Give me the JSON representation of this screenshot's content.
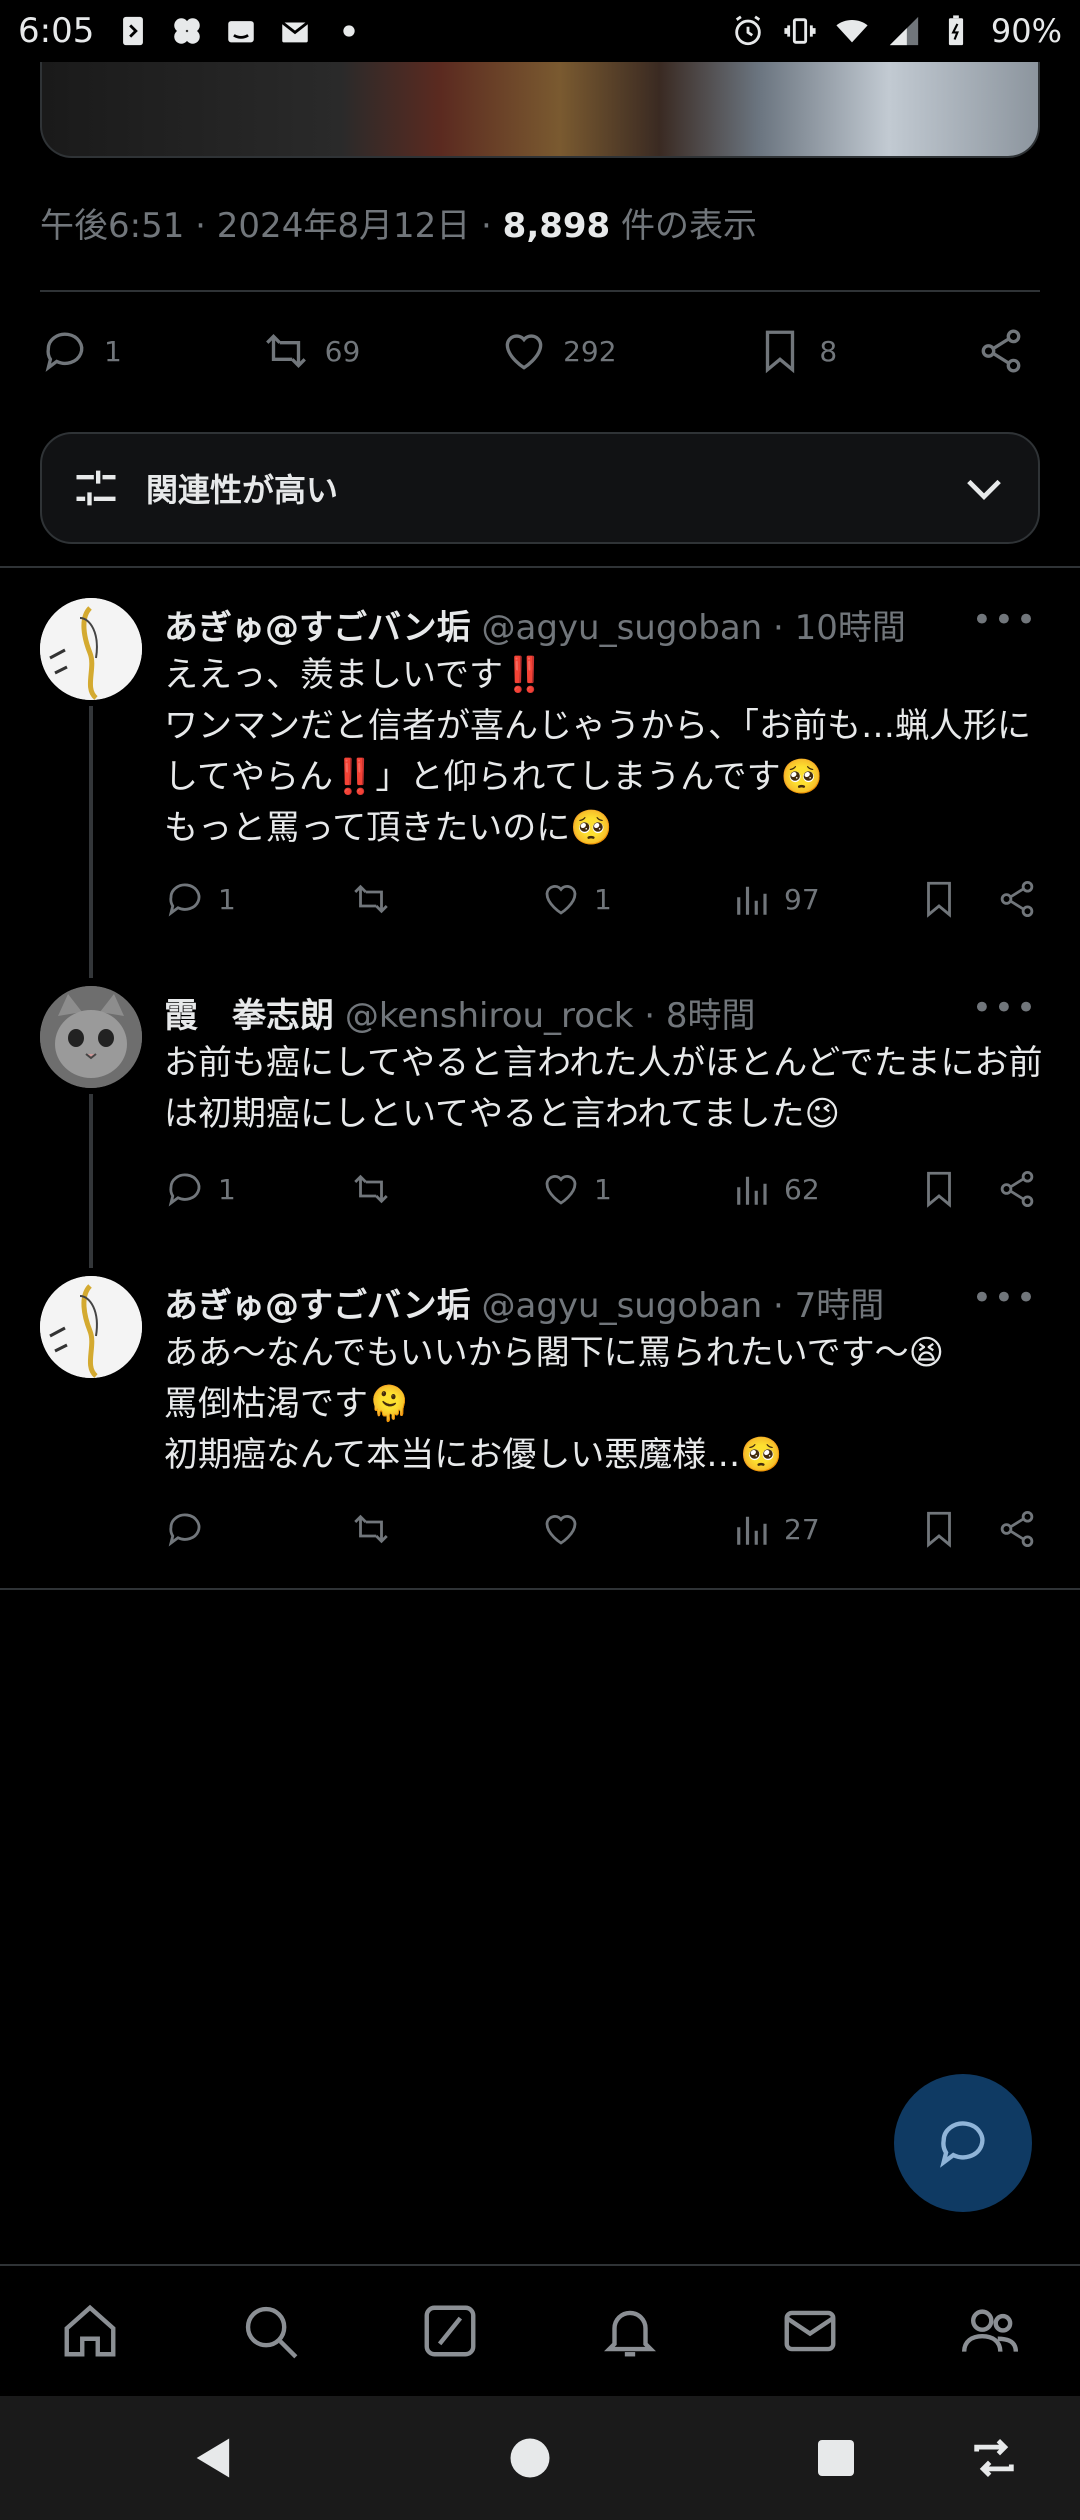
{
  "status_bar": {
    "time": "6:05",
    "battery": "90%"
  },
  "tweet": {
    "time": "午後6:51",
    "date": "2024年8月12日",
    "views_count": "8,898",
    "views_label": "件の表示",
    "replies": "1",
    "reposts": "69",
    "likes": "292",
    "bookmarks": "8"
  },
  "sort": {
    "label": "関連性が高い"
  },
  "replies": [
    {
      "name": "あぎゅ@すごバン垢",
      "handle": "@agyu_sugoban",
      "time": "· 10時間",
      "body": "ええっ、羨ましいです‼️\nワンマンだと信者が喜んじゃうから、「お前も…蝋人形にしてやらん‼️」と仰られてしまうんです🥺\nもっと罵って頂きたいのに🥺",
      "replies": "1",
      "reposts": "",
      "likes": "1",
      "views": "97"
    },
    {
      "name": "霞　拳志朗",
      "handle": "@kenshirou_rock",
      "time": "· 8時間",
      "body": "お前も癌にしてやると言われた人がほとんどでたまにお前は初期癌にしといてやると言われてました😉",
      "replies": "1",
      "reposts": "",
      "likes": "1",
      "views": "62"
    },
    {
      "name": "あぎゅ@すごバン垢",
      "handle": "@agyu_sugoban",
      "time": "· 7時間",
      "body": "ああ〜なんでもいいから閣下に罵られたいです〜😫\n罵倒枯渇です🫠\n初期癌なんて本当にお優しい悪魔様…🥺",
      "replies": "",
      "reposts": "",
      "likes": "",
      "views": "27"
    }
  ],
  "more_label": "•••",
  "colors": {
    "background": "#000000",
    "text": "#e7e9ea",
    "secondary": "#71767b",
    "border": "#2f3336",
    "fab": "#0f3a63"
  }
}
